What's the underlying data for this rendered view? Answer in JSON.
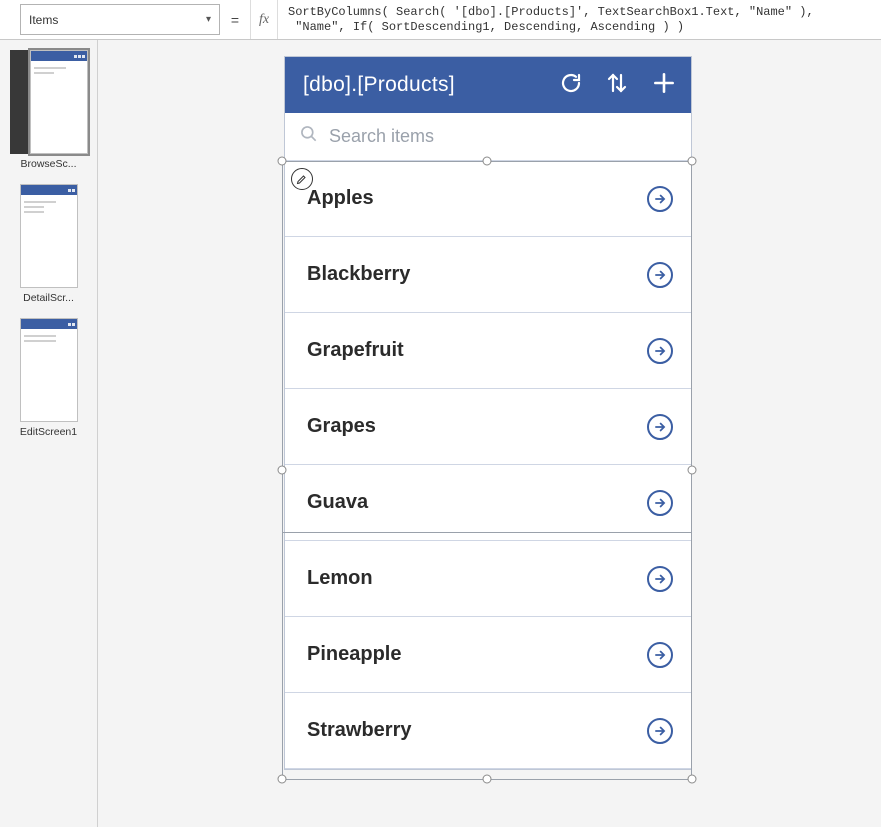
{
  "propertyDropdown": {
    "selected": "Items"
  },
  "formula": "SortByColumns( Search( '[dbo].[Products]', TextSearchBox1.Text, \"Name\" ),\n \"Name\", If( SortDescending1, Descending, Ascending ) )",
  "equalsSign": "=",
  "fxLabel": "fx",
  "screens": [
    {
      "label": "BrowseSc...",
      "variant": "browse"
    },
    {
      "label": "DetailScr...",
      "variant": "detail"
    },
    {
      "label": "EditScreen1",
      "variant": "edit"
    }
  ],
  "app": {
    "title": "[dbo].[Products]",
    "searchPlaceholder": "Search items",
    "items": [
      {
        "name": "Apples"
      },
      {
        "name": "Blackberry"
      },
      {
        "name": "Grapefruit"
      },
      {
        "name": "Grapes"
      },
      {
        "name": "Guava"
      },
      {
        "name": "Lemon"
      },
      {
        "name": "Pineapple"
      },
      {
        "name": "Strawberry"
      }
    ]
  }
}
